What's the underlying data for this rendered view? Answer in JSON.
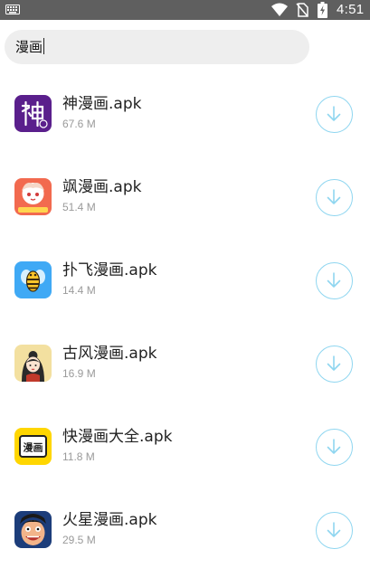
{
  "status_bar": {
    "time": "4:51"
  },
  "search": {
    "query": "漫画"
  },
  "files": [
    {
      "name": "神漫画.apk",
      "size": "67.6 M",
      "icon": "shen-manhua-app-icon"
    },
    {
      "name": "飒漫画.apk",
      "size": "51.4 M",
      "icon": "sa-manhua-app-icon"
    },
    {
      "name": "扑飞漫画.apk",
      "size": "14.4 M",
      "icon": "pufei-manhua-app-icon"
    },
    {
      "name": "古风漫画.apk",
      "size": "16.9 M",
      "icon": "gufeng-manhua-app-icon"
    },
    {
      "name": "快漫画大全.apk",
      "size": "11.8 M",
      "icon": "kuai-manhua-app-icon"
    },
    {
      "name": "火星漫画.apk",
      "size": "29.5 M",
      "icon": "huoxing-manhua-app-icon"
    }
  ],
  "icon_text": {
    "kuai_logo": "漫画"
  },
  "colors": {
    "accent": "#8fd6f0",
    "status_bar": "#5f5f5f",
    "search_bg": "#eeeeee"
  }
}
